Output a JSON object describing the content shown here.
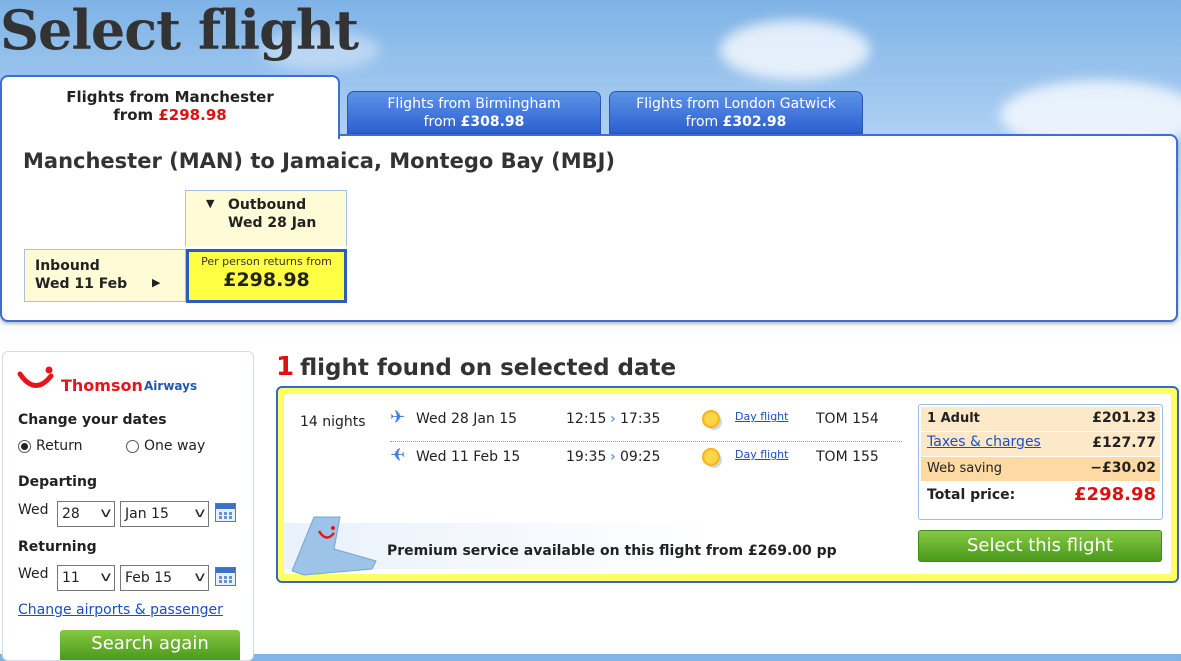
{
  "page": {
    "title": "Select flight"
  },
  "tabs": [
    {
      "label": "Flights from Manchester",
      "from_text": "from",
      "price": "£298.98",
      "active": true
    },
    {
      "label": "Flights from Birmingham",
      "from_text": "from",
      "price": "£308.98",
      "active": false
    },
    {
      "label": "Flights from London Gatwick",
      "from_text": "from",
      "price": "£302.98",
      "active": false
    }
  ],
  "route": {
    "title": "Manchester (MAN) to Jamaica, Montego Bay (MBJ)",
    "outbound": {
      "label": "Outbound",
      "date": "Wed 28 Jan"
    },
    "inbound": {
      "label": "Inbound",
      "date": "Wed 11 Feb"
    },
    "price_box": {
      "caption": "Per person returns from",
      "price": "£298.98"
    }
  },
  "sidebar": {
    "brand_name": "Thomson",
    "brand_sub": "Airways",
    "change_dates_label": "Change your dates",
    "trip_types": [
      {
        "label": "Return",
        "selected": true
      },
      {
        "label": "One way",
        "selected": false
      }
    ],
    "departing": {
      "label": "Departing",
      "day": "Wed",
      "date": "28",
      "month": "Jan 15"
    },
    "returning": {
      "label": "Returning",
      "day": "Wed",
      "date": "11",
      "month": "Feb 15"
    },
    "change_link": "Change airports & passenger",
    "search_button": "Search again"
  },
  "results": {
    "count": "1",
    "heading": "flight found on selected date",
    "nights": "14 nights",
    "legs": [
      {
        "direction_icon": "plane-depart-icon",
        "date": "Wed 28 Jan 15",
        "depart": "12:15",
        "arrive": "17:35",
        "type": "Day flight",
        "flight": "TOM 154"
      },
      {
        "direction_icon": "plane-return-icon",
        "date": "Wed 11 Feb 15",
        "depart": "19:35",
        "arrive": "09:25",
        "type": "Day flight",
        "flight": "TOM 155"
      }
    ],
    "price_breakdown": {
      "adult_label": "1 Adult",
      "adult_value": "£201.23",
      "taxes_label": "Taxes & charges",
      "taxes_value": "£127.77",
      "saving_label": "Web saving",
      "saving_value": "−£30.02",
      "total_label": "Total price:",
      "total_value": "£298.98"
    },
    "premium_text": "Premium service available on this flight from £269.00 pp",
    "select_button": "Select this flight"
  },
  "colors": {
    "accent_blue": "#3e6fd0",
    "price_red": "#d11111",
    "highlight_yellow": "#ffff44",
    "button_green": "#5aa825",
    "brand_red": "#e8141c"
  }
}
